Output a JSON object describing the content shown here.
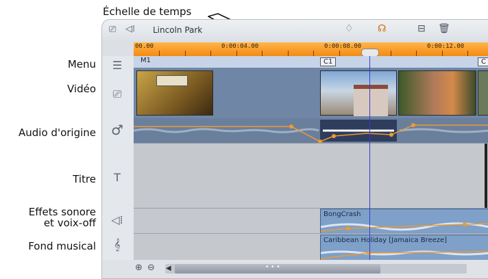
{
  "callouts": {
    "timescale": "Échelle de temps",
    "menu": "Menu",
    "video": "Vidéo",
    "orig_audio": "Audio d'origine",
    "title": "Titre",
    "sfx_line1": "Effets sonore",
    "sfx_line2": "et voix-off",
    "music": "Fond musical"
  },
  "toolbar": {
    "track_name": "Lincoln Park",
    "icons": [
      "camera-icon",
      "speaker-icon",
      "marker-icon",
      "audio-scrub-icon",
      "split-icon",
      "trash-icon"
    ]
  },
  "ruler": {
    "labels": [
      "00.00",
      "0:00:04.00",
      "0:00:08.00",
      "0:00:12.00"
    ]
  },
  "tracks": {
    "menu_clip": "M1",
    "chapter_clip": "C1",
    "chapter_clip_2": "C",
    "sfx_clip": "BongCrash",
    "music_clip": "Caribbean Holiday [Jamaica Breeze]"
  },
  "bottom": {
    "zoom_in": "⊕",
    "zoom_out": "⊖",
    "scroll_left": "◀",
    "grip": "• • •"
  },
  "colors": {
    "ruler": "#f48a12",
    "playhead": "#3a3ad0",
    "clip": "#7ea0c9"
  }
}
